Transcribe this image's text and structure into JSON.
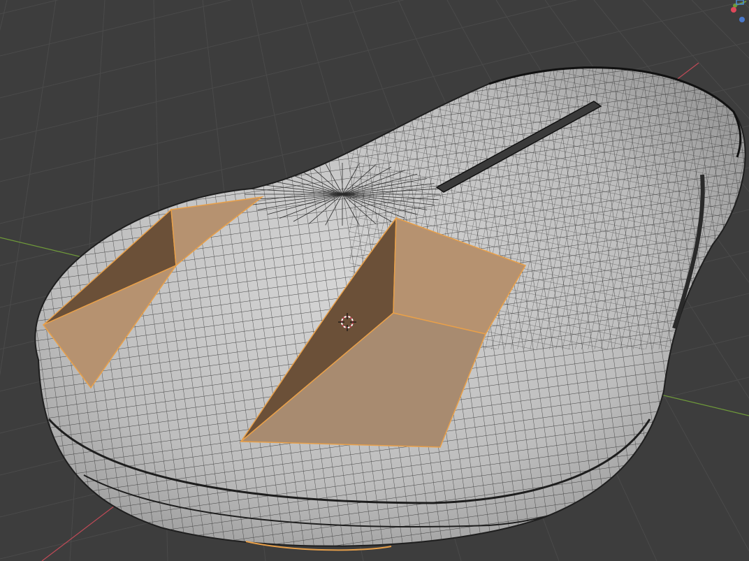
{
  "viewport": {
    "mode": "edit-mode",
    "view": "perspective",
    "background_color": "#3d3d3d",
    "grid_color": "#4a4a4a",
    "x_axis_color": "#c04a57",
    "y_axis_color": "#6f9a3a",
    "mesh_color": "#b9b9b9",
    "wire_color": "#2a2a2a",
    "selection_color": "#e8a04a",
    "selected_face_color": "#b69270",
    "selected_face_dark_color": "#6b5038",
    "cursor_icon": "3d-cursor-icon",
    "gizmo_icon": "navigation-gizmo-icon"
  }
}
